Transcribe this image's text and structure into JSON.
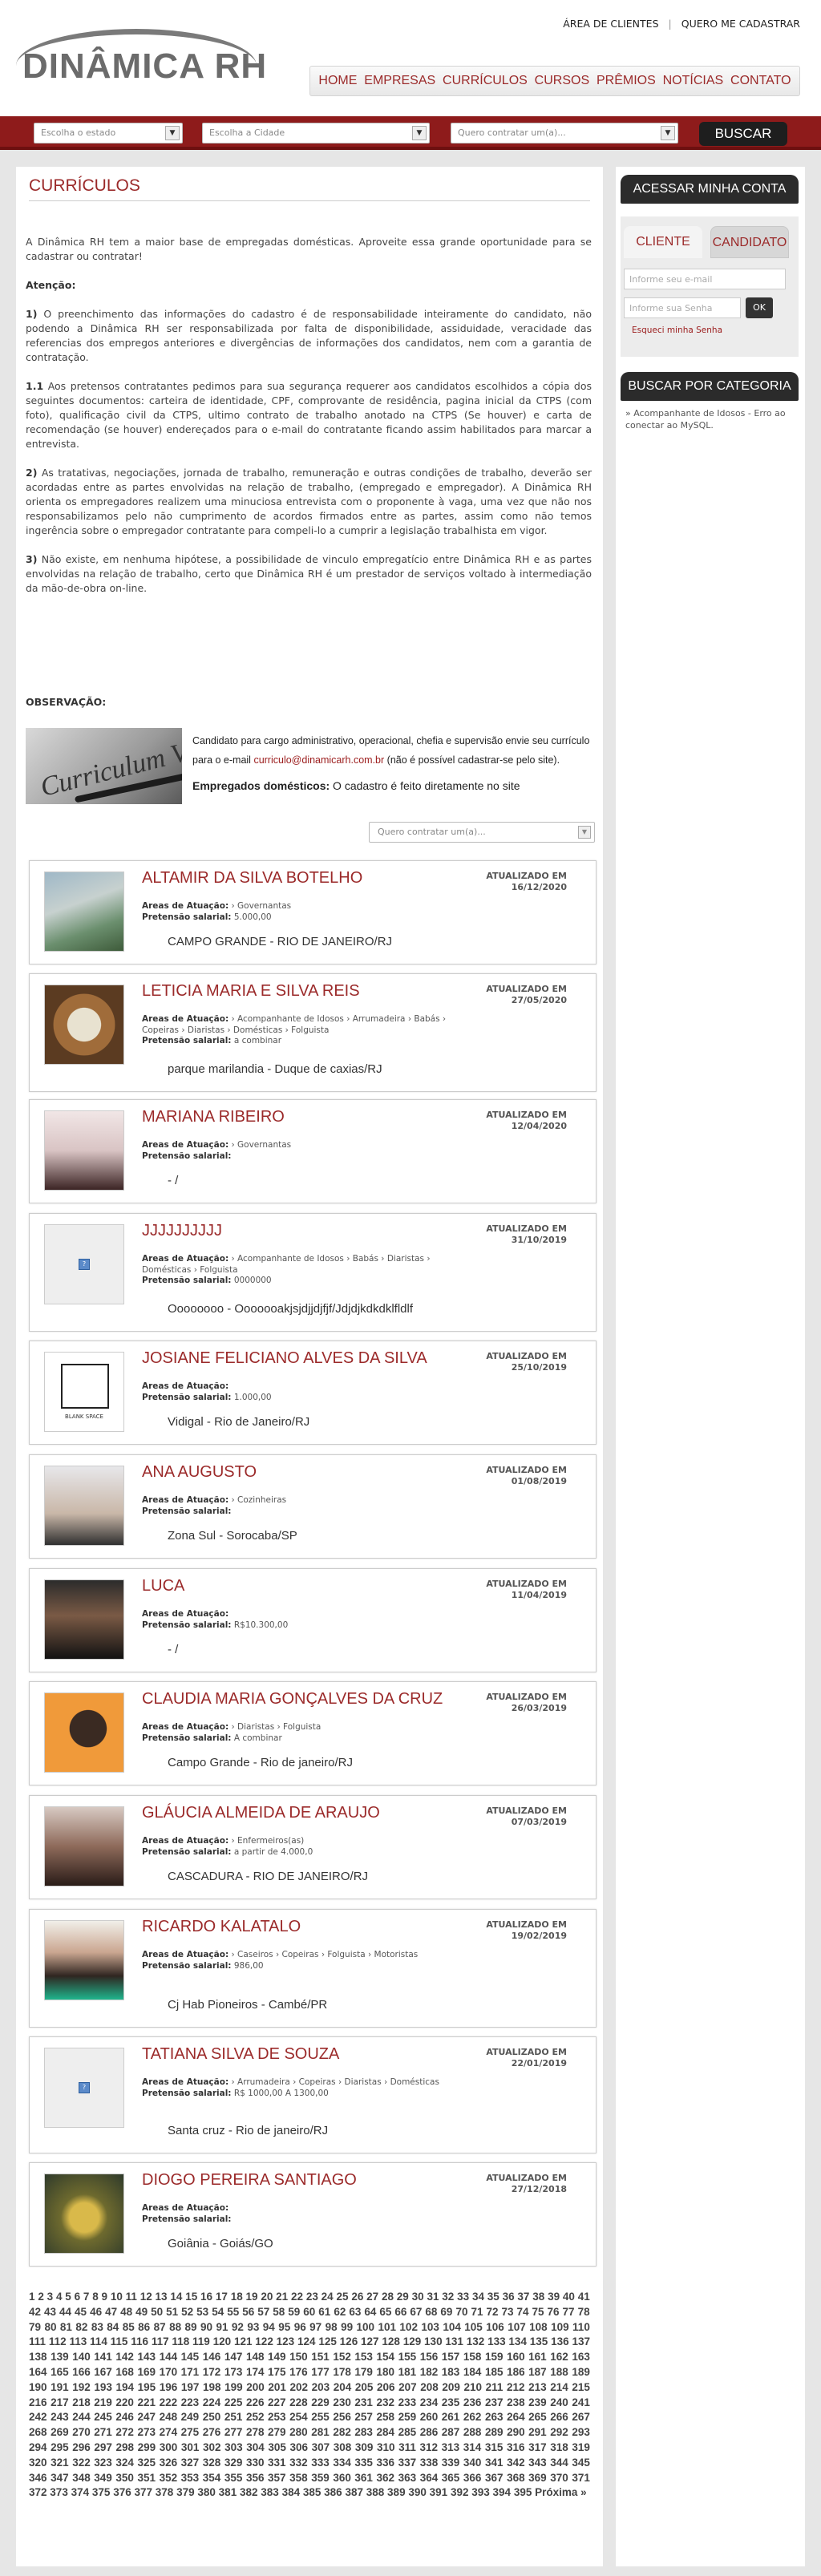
{
  "header": {
    "logo_text": "DINÂMICA RH",
    "top_links": [
      "ÁREA DE CLIENTES",
      "QUERO ME CADASTRAR"
    ],
    "top_sep": "|",
    "nav": [
      "HOME",
      "EMPRESAS",
      "CURRÍCULOS",
      "CURSOS",
      "PRÊMIOS",
      "NOTÍCIAS",
      "CONTATO"
    ]
  },
  "search": {
    "state_placeholder": "Escolha o estado",
    "city_placeholder": "Escolha a Cidade",
    "hire_placeholder": "Quero contratar um(a)...",
    "button": "BUSCAR"
  },
  "page": {
    "title": "CURRÍCULOS",
    "intro": "A Dinâmica RH tem a maior base de empregadas domésticas. Aproveite essa grande oportunidade para se cadastrar ou contratar!",
    "attention": "Atenção:",
    "p1_num": "1)",
    "p1": "O preenchimento das informações do cadastro é de responsabilidade inteiramente do candidato, não podendo a Dinâmica RH ser responsabilizada por falta de disponibilidade, assiduidade, veracidade das referencias dos empregos anteriores e divergências de informações dos candidatos, nem com a garantia de contratação.",
    "p11_num": "1.1",
    "p11": "Aos pretensos contratantes pedimos para sua segurança requerer aos candidatos escolhidos a cópia dos seguintes documentos: carteira de identidade, CPF, comprovante de residência, pagina inicial da CTPS (com foto), qualificação civil da CTPS, ultimo contrato de trabalho anotado na CTPS (Se houver) e carta de recomendação (se houver) endereçados para o e-mail do contratante ficando assim habilitados para marcar a entrevista.",
    "p2_num": "2)",
    "p2": "As tratativas, negociações, jornada de trabalho, remuneração e outras condições de trabalho, deverão ser acordadas entre as partes envolvidas na relação de trabalho, (empregado e empregador). A Dinâmica RH orienta os empregadores realizem uma minuciosa entrevista com o proponente à vaga, uma vez que não nos responsabilizamos pelo não cumprimento de acordos firmados entre as partes, assim como não temos ingerência sobre o empregador contratante para compeli-lo a cumprir a legislação trabalhista em vigor.",
    "p3_num": "3)",
    "p3": "Não existe, em nenhuma hipótese, a possibilidade de vinculo empregatício entre Dinâmica RH e as partes envolvidas na relação de trabalho, certo que Dinâmica RH é um prestador de serviços voltado à intermediação da mão-de-obra on-line.",
    "obs_label": "OBSERVAÇÃO:",
    "cv_image_text": "Curriculum Vitae",
    "cv_text_1": "Candidato para cargo administrativo, operacional, chefia e supervisão envie seu currículo para o e-mail",
    "cv_email": "curriculo@dinamicarh.com.br",
    "cv_text_2": "(não é possível cadastrar-se pelo site).",
    "cv_emp_label": "Empregados domésticos:",
    "cv_emp_text": "O cadastro é feito diretamente no site",
    "filter_placeholder": "Quero contratar um(a)..."
  },
  "labels": {
    "updated": "ATUALIZADO EM",
    "areas": "Areas de Atuação:",
    "salary": "Pretensão salarial:"
  },
  "candidates": [
    {
      "name": "ALTAMIR DA SILVA BOTELHO",
      "date": "16/12/2020",
      "areas": "› Governantas",
      "salary": "5.000,00",
      "location": "CAMPO GRANDE - RIO DE JANEIRO/RJ"
    },
    {
      "name": "LETICIA MARIA E SILVA REIS",
      "date": "27/05/2020",
      "areas": "› Acompanhante de Idosos › Arrumadeira › Babás › Copeiras › Diaristas › Domésticas › Folguista",
      "salary": "a combinar",
      "location": "parque marilandia - Duque de caxias/RJ"
    },
    {
      "name": "MARIANA RIBEIRO",
      "date": "12/04/2020",
      "areas": "› Governantas",
      "salary": "",
      "location": "- /"
    },
    {
      "name": "JJJJJJJJJJ",
      "date": "31/10/2019",
      "areas": "› Acompanhante de Idosos › Babás › Diaristas › Domésticas › Folguista",
      "salary": "0000000",
      "location": "Oooooooo - Ooooooakjsjdjjdjfjf/Jdjdjkdkdklfldlf"
    },
    {
      "name": "JOSIANE FELICIANO ALVES DA SILVA",
      "date": "25/10/2019",
      "areas": "",
      "salary": "1.000,00",
      "location": "Vidigal - Rio de Janeiro/RJ"
    },
    {
      "name": "ANA AUGUSTO",
      "date": "01/08/2019",
      "areas": "› Cozinheiras",
      "salary": "",
      "location": "Zona Sul - Sorocaba/SP"
    },
    {
      "name": "LUCA",
      "date": "11/04/2019",
      "areas": "",
      "salary": "R$10.300,00",
      "location": "- /"
    },
    {
      "name": "CLAUDIA MARIA GONÇALVES DA CRUZ",
      "date": "26/03/2019",
      "areas": "› Diaristas › Folguista",
      "salary": "A combinar",
      "location": "Campo Grande - Rio de janeiro/RJ"
    },
    {
      "name": "GLÁUCIA ALMEIDA DE ARAUJO",
      "date": "07/03/2019",
      "areas": "› Enfermeiros(as)",
      "salary": "a partir de 4.000,0",
      "location": "CASCADURA - RIO DE JANEIRO/RJ"
    },
    {
      "name": "RICARDO KALATALO",
      "date": "19/02/2019",
      "areas": "› Caseiros › Copeiras › Folguista › Motoristas",
      "salary": "986,00",
      "location": "Cj Hab Pioneiros - Cambé/PR"
    },
    {
      "name": "TATIANA SILVA DE SOUZA",
      "date": "22/01/2019",
      "areas": "› Arrumadeira › Copeiras › Diaristas › Domésticas",
      "salary": "R$ 1000,00 A 1300,00",
      "location": "Santa cruz - Rio de janeiro/RJ"
    },
    {
      "name": "DIOGO PEREIRA SANTIAGO",
      "date": "27/12/2018",
      "areas": "",
      "salary": "",
      "location": "Goiânia - Goiás/GO"
    }
  ],
  "pagination": {
    "last_page": 395,
    "next_label": "Próxima »"
  },
  "sidebar": {
    "account_title": "ACESSAR MINHA CONTA",
    "tab_client": "CLIENTE",
    "tab_candidate": "CANDIDATO",
    "email_placeholder": "Informe seu e-mail",
    "password_placeholder": "Informe sua Senha",
    "ok_label": "OK",
    "forgot_label": "Esqueci minha Senha",
    "category_title": "BUSCAR POR CATEGORIA",
    "category_item": "» Acompanhante de Idosos - Erro ao conectar ao MySQL."
  }
}
